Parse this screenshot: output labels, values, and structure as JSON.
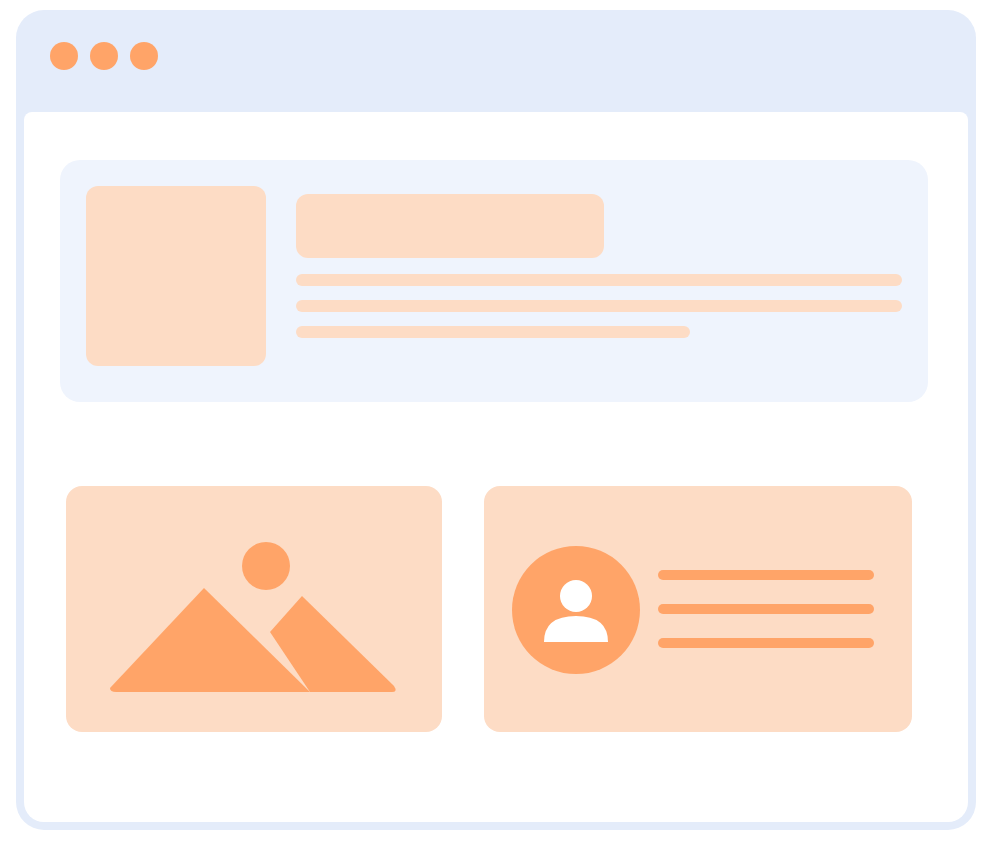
{
  "window": {
    "controls": [
      {
        "kind": "dot"
      },
      {
        "kind": "dot"
      },
      {
        "kind": "dot"
      }
    ]
  },
  "header_card": {
    "kind": "media"
  },
  "cards": [
    {
      "kind": "image"
    },
    {
      "kind": "profile"
    }
  ]
}
